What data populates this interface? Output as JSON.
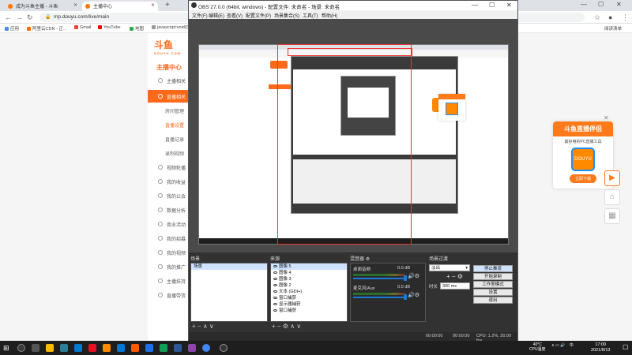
{
  "browser": {
    "tabs": [
      {
        "label": "成为斗鱼主播 - 斗鱼"
      },
      {
        "label": "主播中心"
      }
    ],
    "url": "mp.douyu.com/live/main",
    "bookmarks": [
      "应用",
      "阿里云CDN - 正...",
      "Gmail",
      "YouTube",
      "地图",
      "javascript:void(0)"
    ],
    "reading_list": "阅读清单"
  },
  "site": {
    "logo": "斗鱼",
    "logo_sub": "DOUYU.COM",
    "center_title": "主播中心",
    "sidebar": [
      {
        "label": "主播相关"
      },
      {
        "label": "直播相关",
        "active": true
      },
      {
        "label": "房间管理",
        "sub": true
      },
      {
        "label": "直播设置",
        "sub": true,
        "selected": true
      },
      {
        "label": "直播记录",
        "sub": true
      },
      {
        "label": "录制视频",
        "sub": true
      },
      {
        "label": "视频轮播"
      },
      {
        "label": "我的收益"
      },
      {
        "label": "我的公会"
      },
      {
        "label": "数据分析"
      },
      {
        "label": "商业活动"
      },
      {
        "label": "我的招募"
      },
      {
        "label": "我的视频"
      },
      {
        "label": "我的推广"
      },
      {
        "label": "主播扶持"
      },
      {
        "label": "直播带货"
      }
    ],
    "promo": {
      "title": "斗鱼直播伴侣",
      "desc": "最好用的PC直播工具",
      "app_label": "DOUYU",
      "download": "立即下载"
    }
  },
  "obs": {
    "title": "OBS 27.0.0 (64bit, windows) - 配置文件: 未命名 - 场景: 未命名",
    "menu": [
      "文件(F)",
      "编辑(E)",
      "查看(V)",
      "配置文件(P)",
      "场景集合(S)",
      "工具(T)",
      "帮助(H)"
    ],
    "scenes": {
      "title": "场景",
      "items": [
        "场景"
      ]
    },
    "sources": {
      "title": "来源",
      "items": [
        "图像 5",
        "图像 4",
        "图像 3",
        "图像 2",
        "文本 (GDI+)",
        "窗口捕获",
        "显示器捕获",
        "窗口捕获"
      ]
    },
    "mixer": {
      "title": "混音器",
      "tracks": [
        {
          "name": "桌面音频",
          "db": "0.0 dB"
        },
        {
          "name": "麦克风/Aux",
          "db": "0.0 dB"
        }
      ]
    },
    "transitions": {
      "title": "场景过渡",
      "type": "淡出",
      "duration_label": "时长",
      "duration": "300 ms"
    },
    "controls": [
      "停止推流",
      "开始录制",
      "工作室模式",
      "设置",
      "退出"
    ],
    "status": {
      "live": "00:00:00",
      "rec": "00:00:00",
      "cpu": "CPU: 1.2%, 30.00 fps"
    }
  },
  "taskbar": {
    "temp": "40°C",
    "temp_label": "CPU温度",
    "ime": "中",
    "time": "17:00",
    "date": "2021/8/13"
  },
  "colors": {
    "brand": "#ff6a1a",
    "obs_dark": "#2b2b2b",
    "accent_blue": "#1a7ad9"
  }
}
